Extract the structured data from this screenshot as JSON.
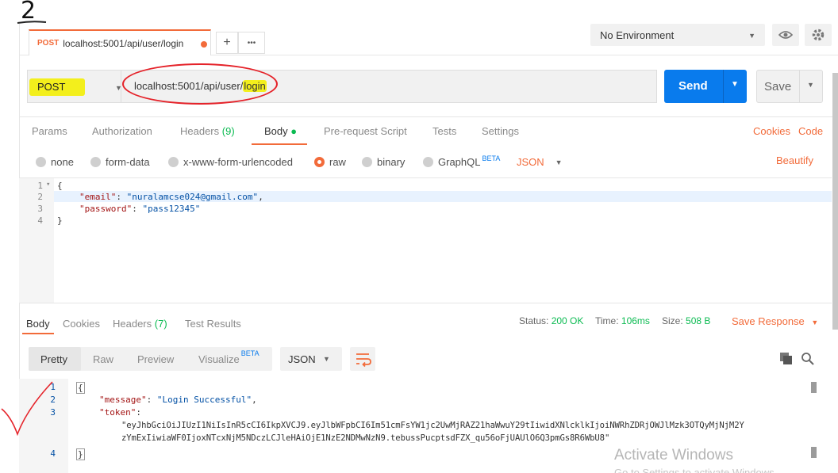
{
  "annotation": {
    "number": "2"
  },
  "tab": {
    "method": "POST",
    "url": "localhost:5001/api/user/login"
  },
  "toolbar": {
    "add": "+",
    "more": "•••"
  },
  "environment": {
    "selected": "No Environment"
  },
  "request": {
    "method": "POST",
    "url_prefix": "localhost:5001/api/user/",
    "url_highlight": "login",
    "send_label": "Send",
    "save_label": "Save"
  },
  "request_tabs": {
    "params": "Params",
    "authorization": "Authorization",
    "headers": "Headers",
    "headers_count": "(9)",
    "body": "Body",
    "prerequest": "Pre-request Script",
    "tests": "Tests",
    "settings": "Settings",
    "cookies": "Cookies",
    "code": "Code"
  },
  "body_types": {
    "none": "none",
    "form_data": "form-data",
    "urlencoded": "x-www-form-urlencoded",
    "raw": "raw",
    "binary": "binary",
    "graphql": "GraphQL",
    "beta": "BETA",
    "format": "JSON",
    "beautify": "Beautify"
  },
  "request_body": {
    "line_numbers": [
      "1",
      "2",
      "3",
      "4"
    ],
    "open": "{",
    "email_key": "\"email\"",
    "email_val": "\"nuralamcse024@gmail.com\"",
    "password_key": "\"password\"",
    "password_val": "\"pass12345\"",
    "close": "}"
  },
  "response_tabs": {
    "body": "Body",
    "cookies": "Cookies",
    "headers": "Headers",
    "headers_count": "(7)",
    "test_results": "Test Results"
  },
  "response_status": {
    "status_label": "Status:",
    "status_val": "200 OK",
    "time_label": "Time:",
    "time_val": "106ms",
    "size_label": "Size:",
    "size_val": "508 B",
    "save_response": "Save Response"
  },
  "view_modes": {
    "pretty": "Pretty",
    "raw": "Raw",
    "preview": "Preview",
    "visualize": "Visualize",
    "beta": "BETA",
    "format": "JSON"
  },
  "response_body": {
    "line_numbers": [
      "1",
      "2",
      "3",
      "4"
    ],
    "open": "{",
    "message_key": "\"message\"",
    "message_val": "\"Login Successful\"",
    "token_key": "\"token\"",
    "token_line1": "\"eyJhbGciOiJIUzI1NiIsInR5cCI6IkpXVCJ9.eyJlbWFpbCI6Im51cmFsYW1jc2UwMjRAZ21haWwuY29tIiwidXNlcklkIjoiNWRhZDRjOWJlMzk3OTQyMjNjM2Y",
    "token_line2": "zYmExIiwiaWF0IjoxNTcxNjM5NDczLCJleHAiOjE1NzE2NDMwNzN9.tebussPucptsdFZX_qu56oFjUAUlO6Q3pmGs8R6WbU8\"",
    "close": "}"
  },
  "watermark": {
    "line1": "Activate Windows",
    "line2": "Go to Settings to activate Windows."
  },
  "colors": {
    "accent": "#f26b3a",
    "send": "#097bed",
    "success": "#0cbb52",
    "highlight": "#f3ef1c",
    "annotation": "#e5232a"
  }
}
